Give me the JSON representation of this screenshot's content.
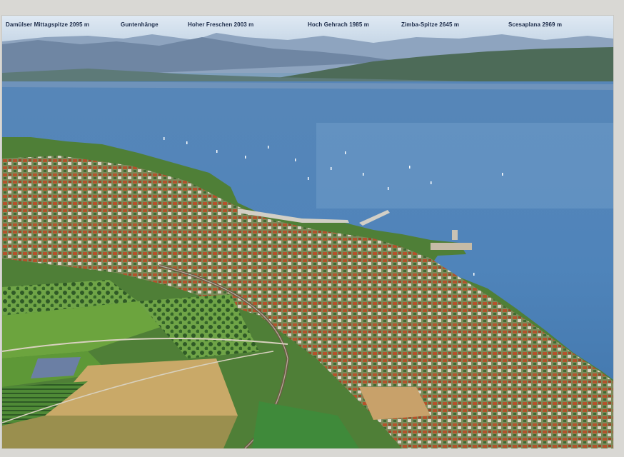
{
  "photo": {
    "alt_subject": "aerial-lake-town",
    "colors": {
      "sky": "#cfe0ef",
      "mountains_far": "#8aa0bc",
      "mountains_near": "#4c6a5c",
      "lake": "#4f83b8",
      "lake_light": "#7fa9d2",
      "town_roofs": "#b0512d",
      "fields_green": "#5f9b3c",
      "fields_yellow": "#c8a460"
    }
  },
  "peaks": [
    {
      "label": "Damülser Mittagspitze 2095 m"
    },
    {
      "label": "Guntenhänge"
    },
    {
      "label": "Hoher Freschen 2003 m"
    },
    {
      "label": "Hoch Gehrach 1985 m"
    },
    {
      "label": "Zimba-Spitze 2645 m"
    },
    {
      "label": "Scesaplana 2969 m"
    }
  ]
}
